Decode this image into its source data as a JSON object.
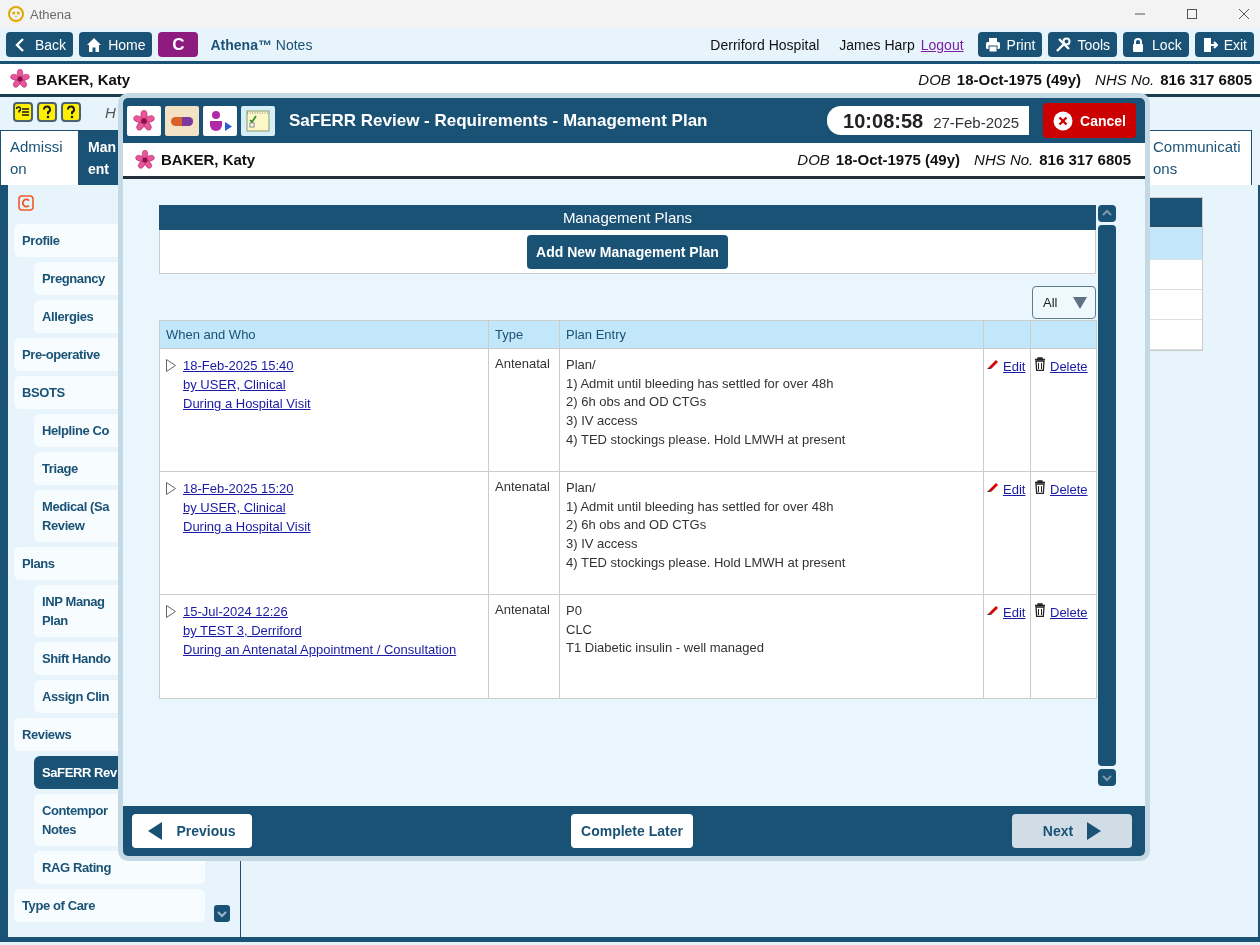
{
  "window": {
    "title": "Athena"
  },
  "toolbar": {
    "buttons_left": [
      {
        "label": "Back",
        "kind": "back"
      },
      {
        "label": "Home",
        "kind": "home"
      },
      {
        "label": "C",
        "kind": "brand"
      }
    ],
    "app_name": "**Athena™** Notes",
    "hospital": "Derriford Hospital",
    "user": "James Harp",
    "logout": "Logout",
    "buttons_right": [
      {
        "label": "Print",
        "kind": "print"
      },
      {
        "label": "Tools",
        "kind": "tools"
      },
      {
        "label": "Lock",
        "kind": "lock"
      },
      {
        "label": "Exit",
        "kind": "exit"
      }
    ]
  },
  "patient": {
    "name": "BAKER, Katy",
    "dob_label": "DOB",
    "dob": "18-Oct-1975 (49y)",
    "nhs_label": "NHS No.",
    "nhs": "816 317 6805"
  },
  "subbar": {
    "text": "H"
  },
  "tabs_left": [
    {
      "label": "Admissi\non",
      "selected": false
    },
    {
      "label": "Man\nent",
      "selected": true
    }
  ],
  "tabs_right": [
    {
      "label": "Communicati\nons",
      "selected": false
    }
  ],
  "sidebar": {
    "items": [
      {
        "label": "Profile",
        "selected": false,
        "children": [
          {
            "label": "Pregnancy",
            "selected": false
          },
          {
            "label": "Allergies",
            "selected": false
          }
        ]
      },
      {
        "label": "Pre-operative",
        "selected": false
      },
      {
        "label": "BSOTS",
        "selected": false,
        "children": [
          {
            "label": "Helpline Co",
            "selected": false
          },
          {
            "label": "Triage",
            "selected": false
          },
          {
            "label": "Medical (Sa\nReview",
            "selected": false
          }
        ]
      },
      {
        "label": "Plans",
        "selected": false,
        "children": [
          {
            "label": "INP Manag\nPlan",
            "selected": false
          },
          {
            "label": "Shift Hando",
            "selected": false
          },
          {
            "label": "Assign Clin",
            "selected": false
          }
        ]
      },
      {
        "label": "Reviews",
        "selected": false,
        "children": [
          {
            "label": "SaFERR Rev",
            "selected": true
          },
          {
            "label": "Contempor\nNotes",
            "selected": false
          },
          {
            "label": "RAG Rating",
            "selected": false
          }
        ]
      },
      {
        "label": "Type of Care",
        "selected": false
      }
    ]
  },
  "dialog": {
    "title": "SaFERR Review - Requirements - Management Plan",
    "time": "10:08:58",
    "date": "27-Feb-2025",
    "cancel": "Cancel",
    "patient": {
      "name": "BAKER, Katy",
      "dob_label": "DOB",
      "dob": "18-Oct-1975 (49y)",
      "nhs_label": "NHS No.",
      "nhs": "816 317 6805"
    },
    "panel_title": "Management Plans",
    "add_button": "Add New Management Plan",
    "filter": "All",
    "table": {
      "columns": [
        "When and Who",
        "Type",
        "Plan Entry"
      ],
      "rows": [
        {
          "expanded": false,
          "when": "18-Feb-2025 15:40",
          "who": "by USER, Clinical",
          "context": "During a Hospital Visit",
          "type": "Antenatal",
          "entry": [
            "Plan/",
            "1) Admit until bleeding has settled for over 48h",
            "2) 6h obs and OD CTGs",
            "3) IV access",
            "4) TED stockings please. Hold LMWH at present"
          ],
          "edit": "Edit",
          "delete": "Delete"
        },
        {
          "expanded": false,
          "when": "18-Feb-2025 15:20",
          "who": "by USER, Clinical",
          "context": "During a Hospital Visit",
          "type": "Antenatal",
          "entry": [
            "Plan/",
            "1) Admit until bleeding has settled for over 48h",
            "2) 6h obs and OD CTGs",
            "3) IV access",
            "4) TED stockings please. Hold LMWH at present"
          ],
          "edit": "Edit",
          "delete": "Delete"
        },
        {
          "expanded": false,
          "when": "15-Jul-2024 12:26",
          "who": "by TEST 3, Derriford",
          "context": "During an Antenatal Appointment / Consultation",
          "type": "Antenatal",
          "entry": [
            "P0",
            "CLC",
            "T1 Diabetic insulin - well managed"
          ],
          "edit": "Edit",
          "delete": "Delete"
        }
      ]
    },
    "footer": {
      "previous": "Previous",
      "complete_later": "Complete Later",
      "next": {
        "label": "Next",
        "disabled": true
      }
    }
  }
}
